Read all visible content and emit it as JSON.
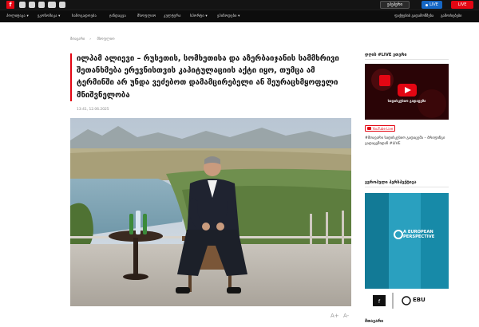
{
  "topbar": {
    "logo_letter": "f",
    "social_icons": [
      "facebook-icon",
      "instagram-icon",
      "x-icon",
      "youtube-icon",
      "tiktok-icon"
    ],
    "epaper_label": "ეპეპერი",
    "live_label": "LIVE",
    "live2_label": "LIVE"
  },
  "nav": {
    "left_items": [
      "პოლიტიკა ▾",
      "ეკონომიკა ▾",
      "საზოგადოება",
      "ჯანდაცვა",
      "მსოფლიო",
      "კულტურა",
      "სპორტი ▾",
      "ეპიზოდები ▾"
    ],
    "right_items": [
      "ფაქტების გადამოწმება",
      "გამოძიებები"
    ]
  },
  "breadcrumb": [
    "მთავარი",
    "მსოფლიო"
  ],
  "article": {
    "headline": "ილჰამ ალიევი – რუსეთის, სომხეთისა და აზერბაიჯანის სამმხრივი შეთანხმება ერევნისთვის კაპიტულაციის აქტი იყო, თუმცა ამ ტერმინში არ უნდა ვეძებოთ დამამცირებელი ან შეურაცხმყოფელი მნიშვნელობა",
    "date": "13:41, 12.06.2025"
  },
  "font_controls": {
    "larger": "A+",
    "smaller": "A-"
  },
  "sidebar": {
    "live_heading": "დღის #LIVE ეთერი",
    "live_thumb_title": "სადისკუსიო გადაცემა",
    "youtube_badge": "YouTube Live",
    "live_text": "#მთავარი სადისკუსიო გადაცემა – ბრიფინგი გადაცემიდან #LIVE",
    "euro_heading": "ევროპული პერსპექტივა",
    "euro_brand": "A EUROPEAN PERSPECTIVE",
    "euro_footer_logo": "EBU",
    "main_heading": "მთავარი"
  },
  "colors": {
    "brand_red": "#e30613",
    "live_blue": "#1667c4",
    "topbar_bg": "#141414",
    "nav_bg": "#0d0d0d",
    "euro_bg": "#1f8fae"
  }
}
